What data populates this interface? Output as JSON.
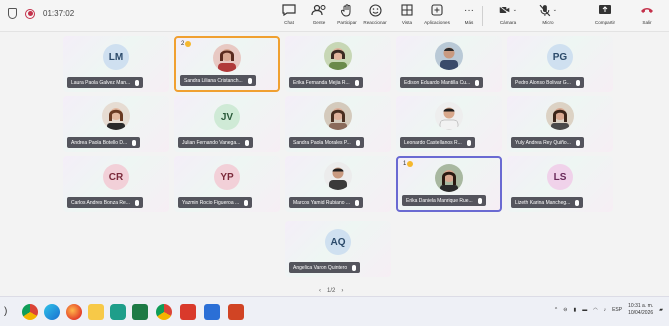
{
  "timer": "01:37:02",
  "toolbar": [
    {
      "key": "chat",
      "label": "Chat"
    },
    {
      "key": "people",
      "label": "Gente"
    },
    {
      "key": "raise",
      "label": "Participar"
    },
    {
      "key": "react",
      "label": "Reaccionar"
    },
    {
      "key": "view",
      "label": "Vista"
    },
    {
      "key": "apps",
      "label": "Aplicaciones"
    },
    {
      "key": "more",
      "label": "Más"
    },
    {
      "key": "camera",
      "label": "Cámara"
    },
    {
      "key": "mic",
      "label": "Micro"
    },
    {
      "key": "share",
      "label": "Compartir"
    },
    {
      "key": "leave",
      "label": "Salir"
    }
  ],
  "participants": [
    {
      "initials": "LM",
      "name": "Laura Paola Galvez Man..."
    },
    {
      "initials": "",
      "name": "Sandra Liliana Cristanch...",
      "hand": "2"
    },
    {
      "initials": "",
      "name": "Erika Fernanda Mejia R..."
    },
    {
      "initials": "",
      "name": "Edison Eduardo Mantilla Cu..."
    },
    {
      "initials": "PG",
      "name": "Pedro Alonso Bolivar G..."
    },
    {
      "initials": "",
      "name": "Andrea Paola Botello D..."
    },
    {
      "initials": "JV",
      "name": "Julian Fernando Vanega..."
    },
    {
      "initials": "",
      "name": "Sandra Paola Morales P..."
    },
    {
      "initials": "",
      "name": "Leonardo Castellanos R..."
    },
    {
      "initials": "",
      "name": "Yuly Andrea Rey Quiño..."
    },
    {
      "initials": "CR",
      "name": "Carlos Andres Bonza Re..."
    },
    {
      "initials": "YP",
      "name": "Yazmin Rocio Figueroa ..."
    },
    {
      "initials": "",
      "name": "Marcos Yamid Rubiano ..."
    },
    {
      "initials": "",
      "name": "Erika Daniela Manrique Rue...",
      "hand": "1"
    },
    {
      "initials": "LS",
      "name": "Lizeth Karina Mancheg..."
    },
    {
      "initials": "AQ",
      "name": "Angelica Varon Quintero"
    }
  ],
  "pager": {
    "prev": "‹",
    "text": "1/2",
    "next": "›"
  },
  "tray": {
    "lang": "ESP",
    "time": "10:31 a. m.",
    "date": "10/04/2026"
  },
  "colors": {
    "leave": "#c4314b",
    "hand": "#f5b82e",
    "highlight_orange": "#f0a030",
    "highlight_blue": "#6a6ad2"
  }
}
